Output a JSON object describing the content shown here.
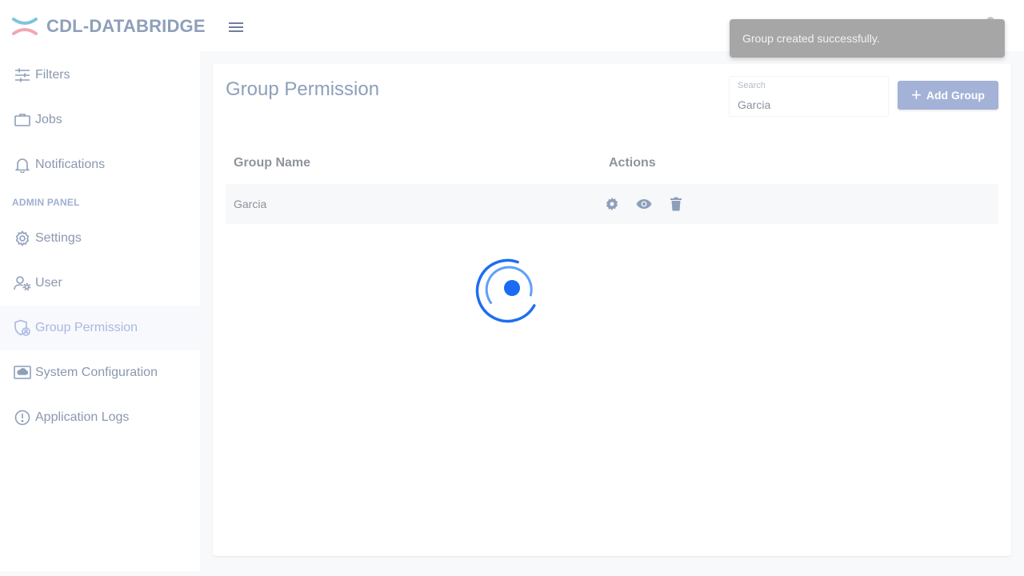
{
  "app": {
    "name": "CDL-DATABRIDGE"
  },
  "sidebar": {
    "items": [
      {
        "label": "Filters",
        "icon": "tune-icon"
      },
      {
        "label": "Jobs",
        "icon": "briefcase-icon"
      },
      {
        "label": "Notifications",
        "icon": "bell-icon"
      }
    ],
    "section_title": "ADMIN PANEL",
    "admin_items": [
      {
        "label": "Settings",
        "icon": "gear-icon"
      },
      {
        "label": "User",
        "icon": "user-gear-icon"
      },
      {
        "label": "Group Permission",
        "icon": "shield-icon",
        "active": true
      },
      {
        "label": "System Configuration",
        "icon": "cloud-screen-icon"
      },
      {
        "label": "Application Logs",
        "icon": "alert-circle-icon"
      }
    ]
  },
  "main": {
    "title": "Group Permission",
    "search": {
      "label": "Search",
      "value": "Garcia"
    },
    "add_button": "Add Group",
    "table": {
      "columns": [
        "Group Name",
        "Actions"
      ],
      "rows": [
        {
          "name": "Garcia",
          "actions": [
            "settings-icon",
            "eye-icon",
            "trash-icon"
          ]
        }
      ]
    },
    "loading": true
  },
  "toast": {
    "message": "Group created successfully."
  },
  "colors": {
    "accent": "#a3b2d6",
    "text_muted": "#8e9fba",
    "spinner": "#1f6ef0",
    "toast_bg": "#a6a6a6"
  }
}
